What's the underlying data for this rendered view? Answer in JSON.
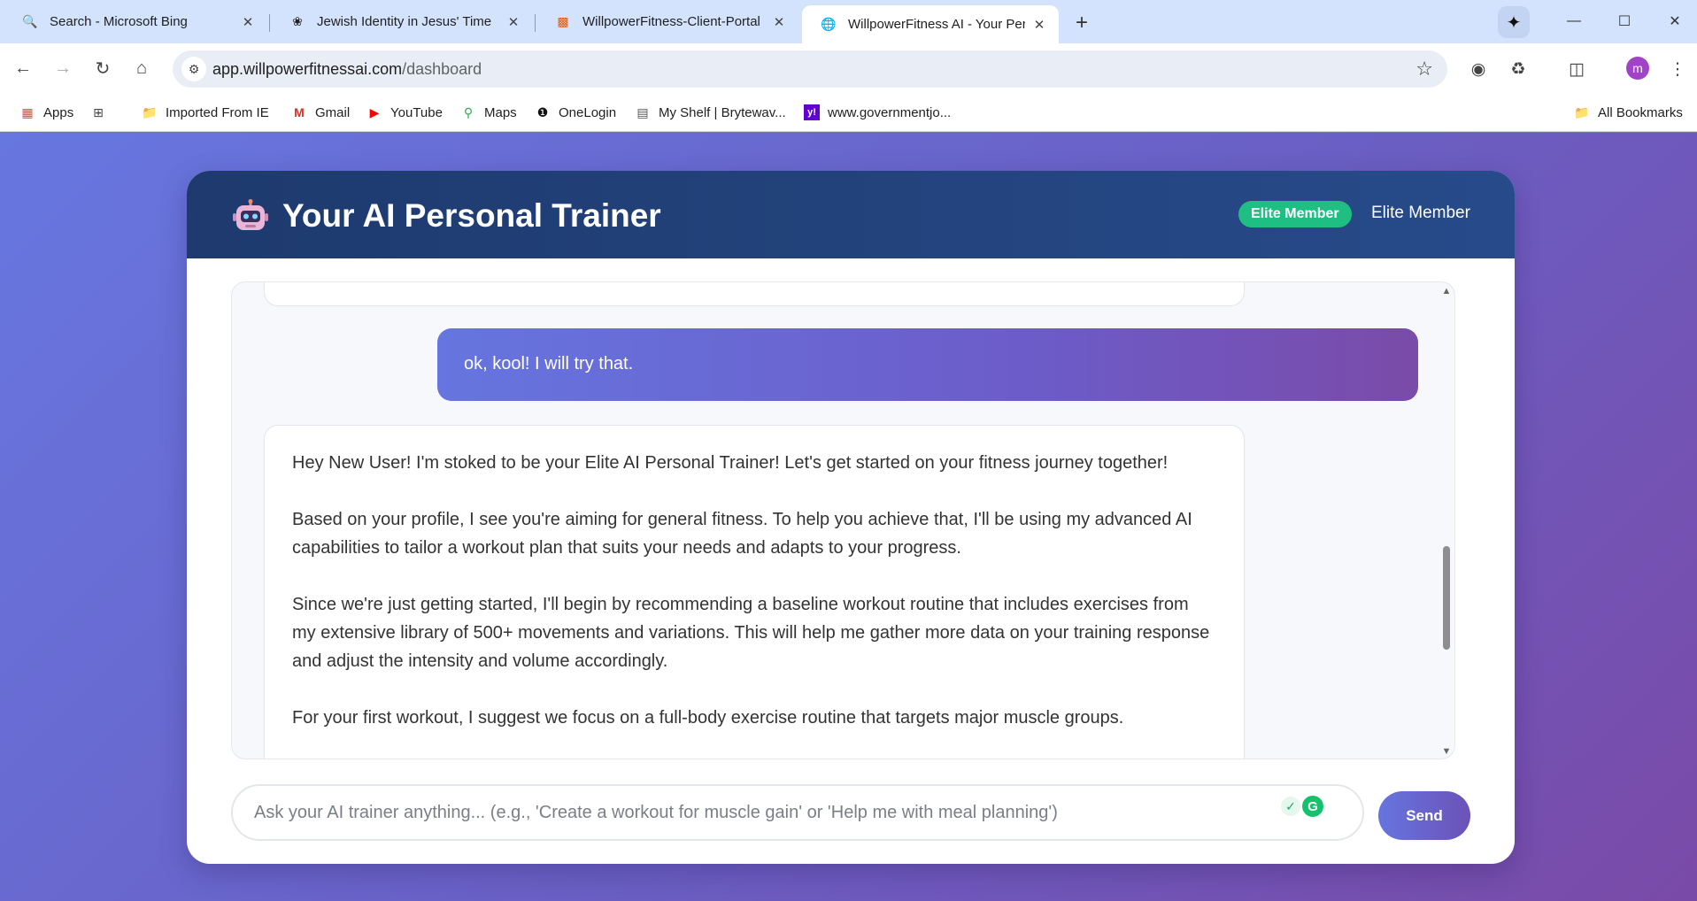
{
  "browser": {
    "tabs": [
      {
        "label": "Search - Microsoft Bing",
        "icon": "search-icon",
        "active": false
      },
      {
        "label": "Jewish Identity in Jesus' Time",
        "icon": "chatgpt-icon",
        "active": false
      },
      {
        "label": "WillpowerFitness-Client-Portal",
        "icon": "app-icon",
        "active": false
      },
      {
        "label": "WillpowerFitness AI - Your Perso",
        "icon": "globe-icon",
        "active": true
      }
    ],
    "url_domain": "app.willpowerfitnessai.com",
    "url_path": "/dashboard",
    "profile_initial": "m",
    "bookmarks": [
      {
        "label": "Apps",
        "icon": "apps-grid-icon"
      },
      {
        "label": "",
        "icon": "tab-groups-icon"
      },
      {
        "label": "Imported From IE",
        "icon": "folder-icon"
      },
      {
        "label": "Gmail",
        "icon": "gmail-icon"
      },
      {
        "label": "YouTube",
        "icon": "youtube-icon"
      },
      {
        "label": "Maps",
        "icon": "maps-icon"
      },
      {
        "label": "OneLogin",
        "icon": "onelogin-icon"
      },
      {
        "label": "My Shelf | Brytewav...",
        "icon": "document-icon"
      },
      {
        "label": "www.governmentjo...",
        "icon": "yahoo-icon"
      }
    ],
    "all_bookmarks": "All Bookmarks"
  },
  "app": {
    "title": "Your AI Personal Trainer",
    "badge": "Elite Member",
    "member_label": "Elite Member",
    "accent_color": "#1fbf84",
    "header_color": "#1e3a6e"
  },
  "chat": {
    "user_message": "ok, kool! I will try that.",
    "ai_paragraphs": [
      "Hey New User! I'm stoked to be your Elite AI Personal Trainer! Let's get started on your fitness journey together!",
      "Based on your profile, I see you're aiming for general fitness. To help you achieve that, I'll be using my advanced AI capabilities to tailor a workout plan that suits your needs and adapts to your progress.",
      "Since we're just getting started, I'll begin by recommending a baseline workout routine that includes exercises from my extensive library of 500+ movements and variations. This will help me gather more data on your training response and adjust the intensity and volume accordingly.",
      "For your first workout, I suggest we focus on a full-body exercise routine that targets major muscle groups."
    ]
  },
  "composer": {
    "placeholder": "Ask your AI trainer anything... (e.g., 'Create a workout for muscle gain' or 'Help me with meal planning')",
    "value": "",
    "send_label": "Send"
  }
}
